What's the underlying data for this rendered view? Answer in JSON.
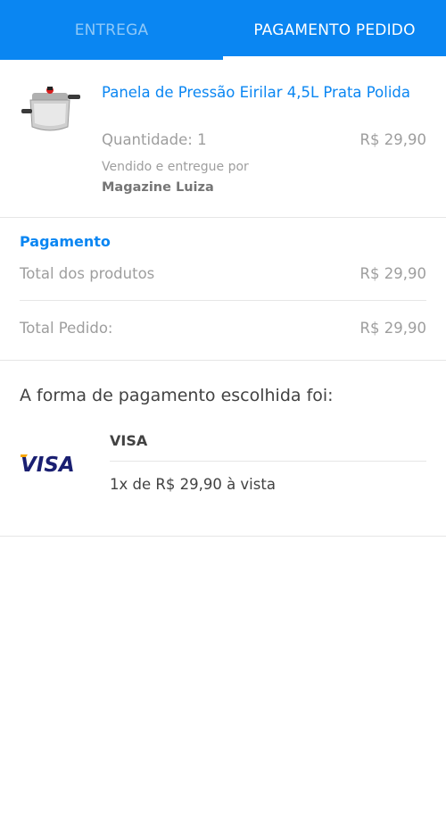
{
  "tabs": {
    "delivery_label": "ENTREGA",
    "payment_label": "PAGAMENTO PEDIDO"
  },
  "product": {
    "name": "Panela de Pressão Eirilar 4,5L Prata Polida",
    "quantity": "Quantidade: 1",
    "price": "R$ 29,90",
    "sold_by": "Vendido e entregue por",
    "seller": "Magazine Luiza",
    "image_icon": "pressure-cooker"
  },
  "payment_summary": {
    "title": "Pagamento",
    "products_label": "Total dos produtos",
    "products_value": "R$ 29,90",
    "total_label": "Total Pedido:",
    "total_value": "R$ 29,90"
  },
  "payment_method": {
    "title": "A forma de pagamento escolhida foi:",
    "logo_text": "VISA",
    "card_brand": "VISA",
    "installments": "1x de R$ 29,90 à vista"
  },
  "colors": {
    "accent": "#0a86f2",
    "visa_blue": "#1a1f71",
    "visa_gold": "#f7a600"
  }
}
